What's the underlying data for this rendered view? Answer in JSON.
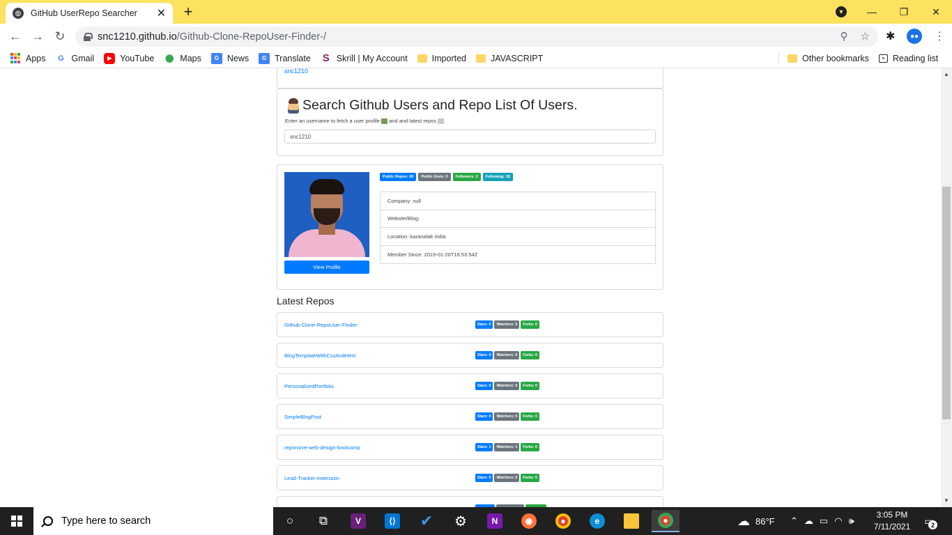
{
  "browser": {
    "tab_title": "GitHub UserRepo Searcher",
    "url_host": "snc1210.github.io",
    "url_path": "/Github-Clone-RepoUser-Finder-/",
    "bookmarks": [
      "Apps",
      "Gmail",
      "YouTube",
      "Maps",
      "News",
      "Translate",
      "Skrill | My Account",
      "Imported",
      "JAVASCRIPT"
    ],
    "other_bookmarks": "Other bookmarks",
    "reading_list": "Reading list"
  },
  "page": {
    "prev_link": "snc1210",
    "heading": "Search Github Users and Repo List Of Users.",
    "lead_part1": "Enter an username to fetch a user profile",
    "lead_part2": "and and latest repos",
    "search_value": "snc1210",
    "profile": {
      "badges": [
        "Public Repos: 60",
        "Public Gists: 0",
        "Followers: 2",
        "Following: 18"
      ],
      "info": [
        "Company: null",
        "Website/Blog:",
        "Location: karanatak india",
        "Member Since: 2019-01-26T16:53:54Z"
      ],
      "view_button": "View Profile"
    },
    "repos_heading": "Latest Repos",
    "repos": [
      {
        "name": "Github-Clone-RepoUser-Finder-",
        "stars": "Stars: 0",
        "watchers": "Watchers: 0",
        "forks": "Forks: 0"
      },
      {
        "name": "BlogTemplateWithCssAndHtml",
        "stars": "Stars: 0",
        "watchers": "Watchers: 0",
        "forks": "Forks: 0"
      },
      {
        "name": "PersonalizedPortfolio",
        "stars": "Stars: 0",
        "watchers": "Watchers: 0",
        "forks": "Forks: 0"
      },
      {
        "name": "SimpleBlogPost",
        "stars": "Stars: 0",
        "watchers": "Watchers: 0",
        "forks": "Forks: 0"
      },
      {
        "name": "reponsive-web-design-bootcamp",
        "stars": "Stars: 1",
        "watchers": "Watchers: 1",
        "forks": "Forks: 0"
      },
      {
        "name": "Lead-Tracker-extension",
        "stars": "Stars: 0",
        "watchers": "Watchers: 0",
        "forks": "Forks: 0"
      }
    ]
  },
  "taskbar": {
    "search_placeholder": "Type here to search",
    "weather": "86°F",
    "time": "3:05 PM",
    "date": "7/11/2021",
    "notifications": "2"
  },
  "colors": {
    "tab_strip": "#fce25e",
    "primary": "#007bff",
    "secondary": "#6c757d",
    "success": "#28a745",
    "info": "#17a2b8",
    "taskbar": "#202020"
  }
}
